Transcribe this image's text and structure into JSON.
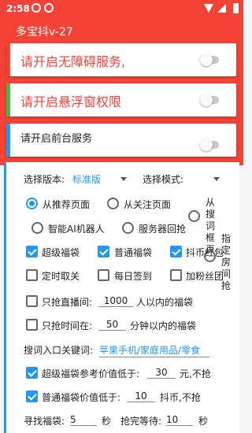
{
  "status": {
    "time": "2:58"
  },
  "app": {
    "title": "多宝抖v-27"
  },
  "cards": [
    {
      "label": "请开启无障碍服务,",
      "accent": "#f44336"
    },
    {
      "label": "请开启悬浮窗权限",
      "accent": "#4caf50"
    },
    {
      "label": "请开启前台服务",
      "accent": "#2196f3"
    }
  ],
  "form": {
    "version_label": "选择版本:",
    "version_value": "标准版",
    "mode_label": "选择模式:",
    "radios": {
      "recommend": "从推荐页面",
      "follow": "从关注页面",
      "search": "从搜词框页",
      "ai": "智能AI机器人",
      "server": "服务器回抢",
      "room": "指定房间抢"
    },
    "checks": {
      "super": "超级福袋",
      "normal": "普通福袋",
      "coin": "抖币红包",
      "timed": "定时取关",
      "daily": "每日签到",
      "fans": "加粉丝团"
    },
    "live_only_prefix": "只抢直播间:",
    "live_only_value": "1000",
    "live_only_suffix": "人以内的福袋",
    "time_only_prefix": "只抢时间在:",
    "time_only_value": "50",
    "time_only_suffix": "分钟以内的福袋",
    "keyword_label": "搜词入口关键词:",
    "keyword_value": "苹果手机/家庭用品/零食",
    "super_ref_prefix": "超级福袋参考价值低于:",
    "super_ref_value": "30",
    "super_ref_suffix": "元,不抢",
    "normal_ref_prefix": "普通福袋价值低于:",
    "normal_ref_value": "10",
    "normal_ref_suffix": "抖币,不抢",
    "find_label": "寻找福袋:",
    "find_value": "5",
    "find_unit": "秒",
    "wait_label": "抢完等待:",
    "wait_value": "10",
    "wait_unit": "秒"
  },
  "colors": {
    "primary": "#f44336",
    "accent": "#2196f3"
  }
}
